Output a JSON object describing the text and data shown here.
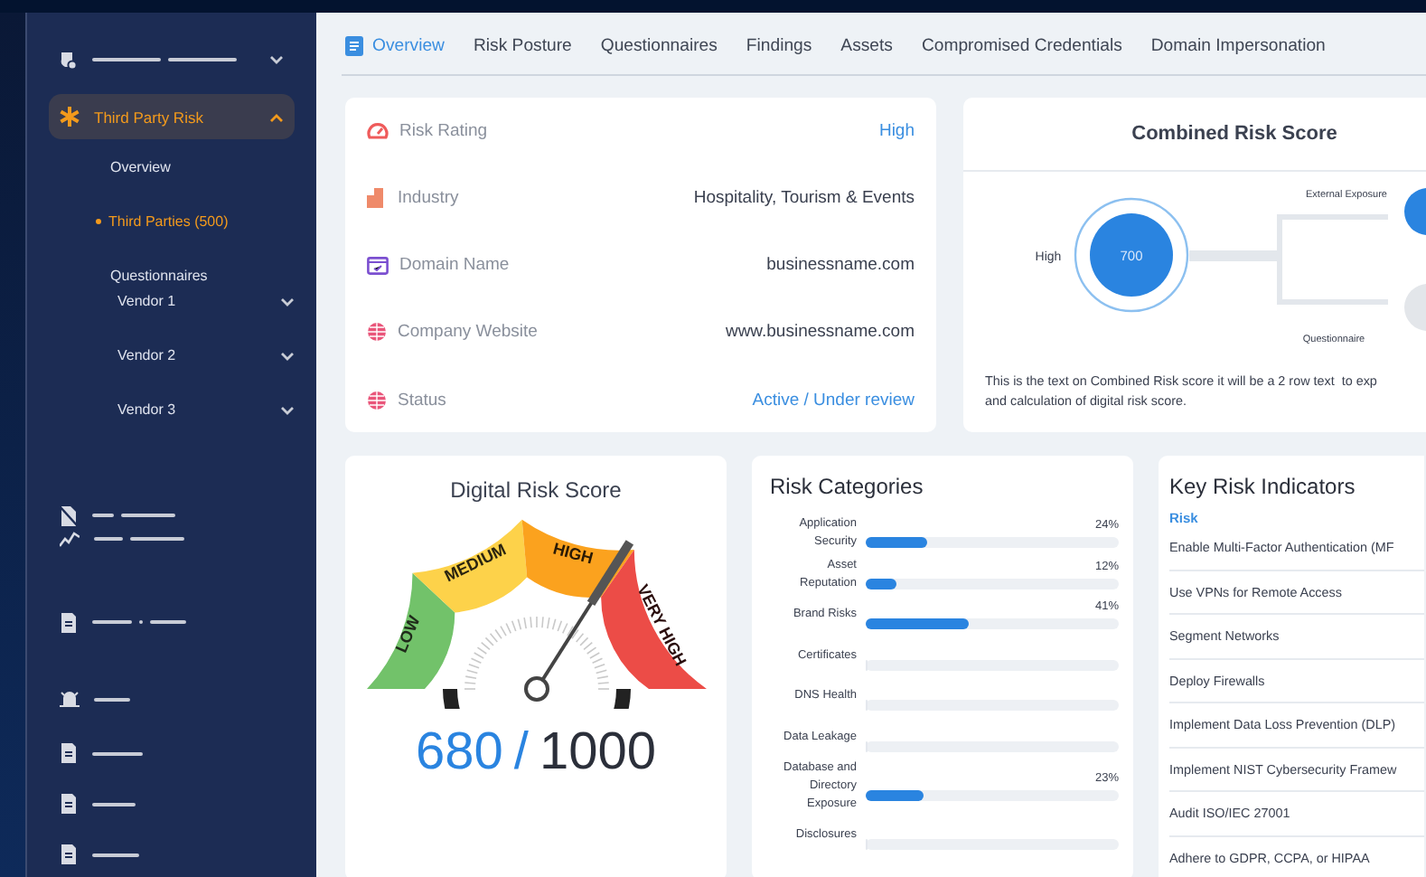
{
  "sidebar": {
    "items": [
      {
        "kind": "redacted",
        "expanded": false
      },
      {
        "kind": "group",
        "label": "Third Party Risk",
        "selected": true,
        "expanded": true,
        "children": [
          {
            "label": "Overview",
            "selected": false
          },
          {
            "label": "Third Parties (500)",
            "selected": true
          },
          {
            "label": "Questionnaires",
            "selected": false,
            "children": [
              {
                "label": "Vendor 1",
                "expanded": false
              },
              {
                "label": "Vendor 2",
                "expanded": false
              },
              {
                "label": "Vendor 3",
                "expanded": false
              }
            ]
          }
        ]
      },
      {
        "kind": "redacted"
      },
      {
        "kind": "redacted"
      },
      {
        "kind": "redacted"
      },
      {
        "kind": "redacted"
      },
      {
        "kind": "redacted"
      },
      {
        "kind": "redacted"
      },
      {
        "kind": "redacted"
      }
    ]
  },
  "tabs": [
    {
      "label": "Overview",
      "selected": true
    },
    {
      "label": "Risk Posture",
      "selected": false
    },
    {
      "label": "Questionnaires",
      "selected": false
    },
    {
      "label": "Findings",
      "selected": false
    },
    {
      "label": "Assets",
      "selected": false
    },
    {
      "label": "Compromised Credentials",
      "selected": false
    },
    {
      "label": "Domain Impersonation",
      "selected": false
    }
  ],
  "details": [
    {
      "kind": "gauge",
      "label": "Risk Rating",
      "value": "High",
      "emphasis": true
    },
    {
      "kind": "building",
      "label": "Industry",
      "value": "Hospitality, Tourism & Events",
      "emphasis": false
    },
    {
      "kind": "domain",
      "label": "Domain Name",
      "value": "businessname.com",
      "emphasis": false
    },
    {
      "kind": "globe",
      "label": "Company Website",
      "value": "www.businessname.com",
      "emphasis": false
    },
    {
      "kind": "globe",
      "label": "Status",
      "value": "Active / Under review",
      "emphasis": true
    }
  ],
  "combined_risk": {
    "title": "Combined Risk Score",
    "rating": "High",
    "score": "700",
    "sources": [
      "External Exposure",
      "Questionnaire"
    ],
    "note_lines": [
      "This is the text on Combined Risk score it will be a 2 row text  to exp",
      "and calculation of digital risk score."
    ]
  },
  "digital_risk": {
    "title": "Digital Risk Score",
    "bands": [
      "LOW",
      "MEDIUM",
      "HIGH",
      "VERY HIGH"
    ],
    "level": 0.68,
    "score": "680",
    "separator": "/",
    "total": "1000"
  },
  "risk_categories": {
    "title": "Risk Categories",
    "items": [
      {
        "label": "Application Security",
        "level": 0.24,
        "reading": "24%"
      },
      {
        "label": "Asset Reputation",
        "level": 0.12,
        "reading": "12%"
      },
      {
        "label": "Brand Risks",
        "level": 0.41,
        "reading": "41%"
      },
      {
        "label": "Certificates",
        "level": 0
      },
      {
        "label": "DNS Health",
        "level": 0
      },
      {
        "label": "Data Leakage",
        "level": 0
      },
      {
        "label": "Database and Directory Exposure",
        "level": 0.23,
        "reading": "23%"
      },
      {
        "label": "Disclosures",
        "level": 0
      }
    ]
  },
  "key_risk_indicators": {
    "title": "Key Risk Indicators",
    "section": "Risk",
    "items": [
      "Enable Multi-Factor Authentication (MF",
      "Use VPNs for Remote Access",
      "Segment Networks",
      "Deploy Firewalls",
      "Implement Data Loss Prevention (DLP)",
      "Implement NIST Cybersecurity Framew",
      "Audit ISO/IEC 27001",
      "Adhere to GDPR, CCPA, or HIPAA"
    ]
  }
}
